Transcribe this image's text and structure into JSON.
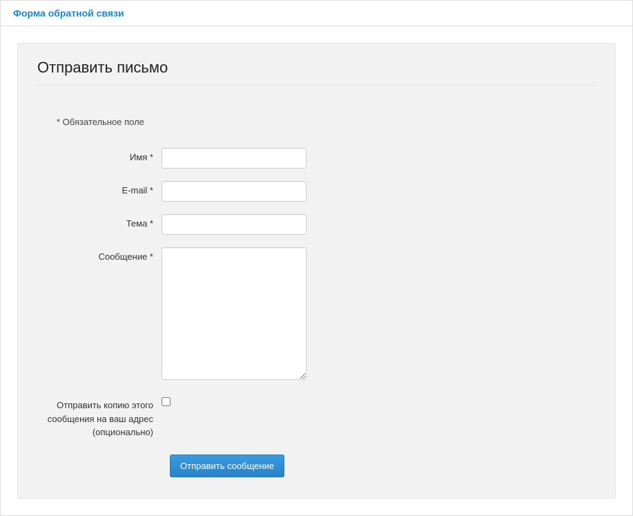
{
  "header": {
    "link_text": "Форма обратной связи"
  },
  "panel": {
    "title": "Отправить письмо",
    "required_note": "* Обязательное поле",
    "fields": {
      "name_label": "Имя *",
      "email_label": "E-mail *",
      "subject_label": "Тема *",
      "message_label": "Сообщение *",
      "copy_label": "Отправить копию этого сообщения на ваш адрес (опционально)"
    },
    "submit_label": "Отправить сообщение"
  }
}
